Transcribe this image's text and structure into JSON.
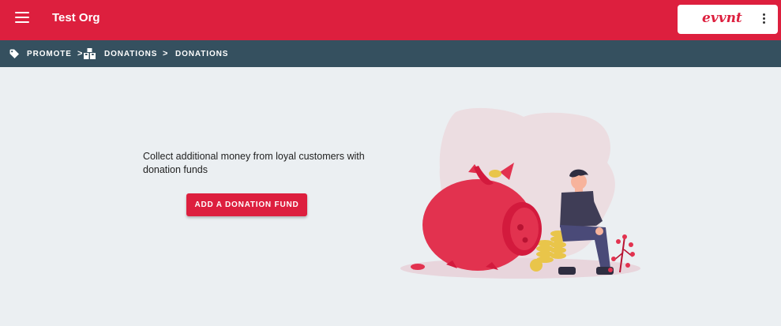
{
  "header": {
    "menu_icon": "hamburger-menu-icon",
    "org_name": "Test Org",
    "logo_text": "evvnt",
    "more_icon": "more-vertical-icon"
  },
  "breadcrumb": {
    "items": [
      "PROMOTE",
      "DONATIONS",
      "DONATIONS"
    ],
    "separator": ">",
    "icons": [
      "tag-icon",
      "boxes-icon"
    ]
  },
  "main": {
    "description": "Collect additional money from loyal customers with donation funds",
    "button_label": "ADD A DONATION FUND",
    "illustration": "piggy-bank-illustration"
  },
  "colors": {
    "brand": "#dd1f3e",
    "breadcrumb_bg": "#35505f",
    "page_bg": "#ebeff2"
  }
}
